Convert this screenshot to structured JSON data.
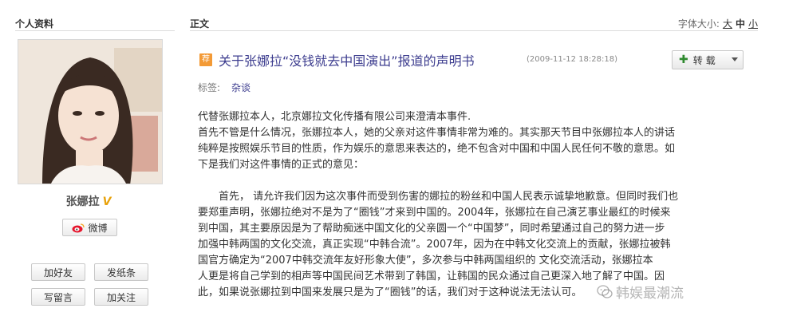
{
  "left": {
    "section_title": "个人资料",
    "profile_name": "张娜拉",
    "verified_badge": "V",
    "weibo_label": "微博",
    "buttons": {
      "add_friend": "加好友",
      "send_note": "发纸条",
      "write_message": "写留言",
      "follow": "加关注"
    }
  },
  "main": {
    "section_title": "正文",
    "font_size": {
      "label": "字体大小:",
      "large": "大",
      "medium": "中",
      "small": "小"
    },
    "article": {
      "badge": "荐",
      "title": "关于张娜拉“没钱就去中国演出”报道的声明书",
      "date": "(2009-11-12 18:28:18)",
      "repost_label": "转载",
      "tags_label": "标签:",
      "tag": "杂谈",
      "lines": [
        "代替张娜拉本人，北京娜拉文化传播有限公司来澄清本事件.",
        "首先不管是什么情况，张娜拉本人，她的父亲对这件事情非常为难的。其实那天节目中张娜拉本人的讲话",
        "纯粹是按照娱乐节目的性质，作为娱乐的意思来表达的，绝不包含对中国和中国人民任何不敬的意思。如",
        "下是我们对这件事情的正式的意见：",
        "",
        "　　首先，  请允许我们因为这次事件而受到伤害的娜拉的粉丝和中国人民表示诚挚地歉意。但同时我们也",
        "要郑重声明，张娜拉绝对不是为了“圈钱”才来到中国的。2004年，张娜拉在自己演艺事业最红的时候来",
        "到中国，其主要原因是为了帮助痴迷中国文化的父亲圆一个“中国梦”，同时希望通过自己的努力进一步",
        "加强中韩两国的文化交流，真正实现“中韩合流”。2007年，因为在中韩文化交流上的贡献，张娜拉被韩",
        "国官方确定为“2007中韩交流年友好形象大使”，多次参与中韩两国组织的  文化交流活动，张娜拉本",
        "人更是将自己学到的相声等中国民间艺术带到了韩国，让韩国的民众通过自己更深入地了解了中国。因",
        "此，如果说张娜拉到中国来发展只是为了“圈钱”的话，我们对于这种说法无法认可。"
      ]
    },
    "watermark": "韩娱最潮流"
  },
  "colors": {
    "title_blue": "#3d3d8f",
    "badge_orange": "#f39a36",
    "verified_gold": "#e8a20c",
    "plus_green": "#2f8a2f"
  }
}
